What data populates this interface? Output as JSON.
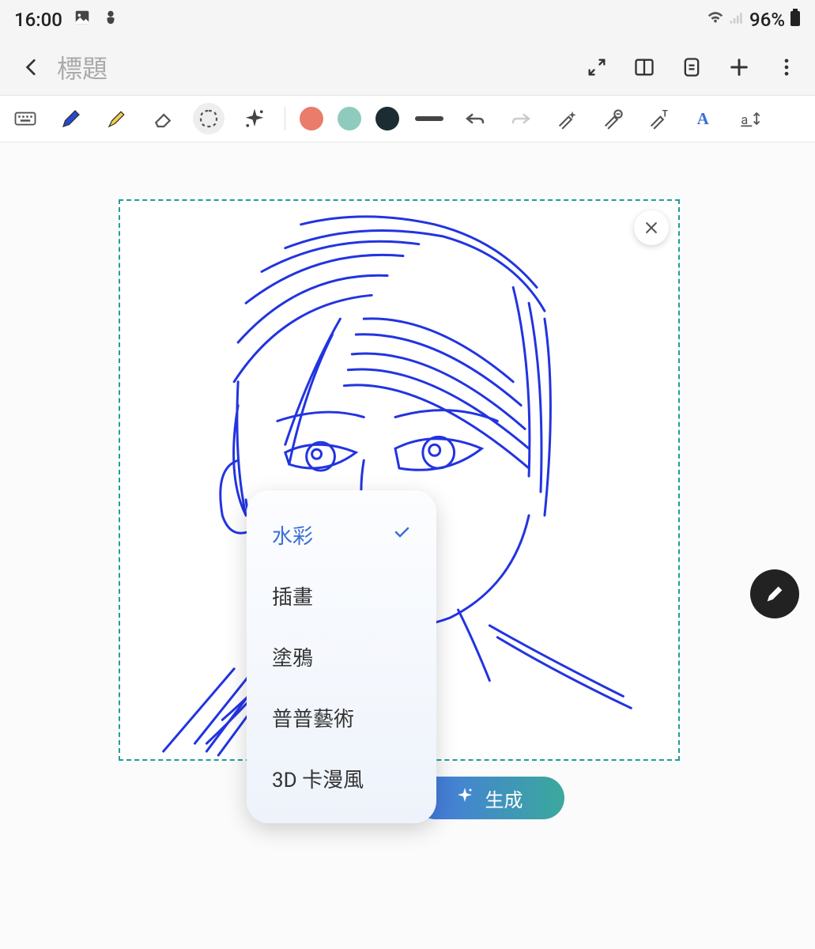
{
  "status": {
    "time": "16:00",
    "battery": "96%"
  },
  "header": {
    "title": "標題"
  },
  "toolbar": {
    "colors": {
      "coral": "#e97c6b",
      "mint": "#8fcbbd",
      "dark": "#1b2d33"
    }
  },
  "dropdown": {
    "items": [
      {
        "label": "水彩",
        "selected": true
      },
      {
        "label": "插畫",
        "selected": false
      },
      {
        "label": "塗鴉",
        "selected": false
      },
      {
        "label": "普普藝術",
        "selected": false
      },
      {
        "label": "3D 卡漫風",
        "selected": false
      }
    ]
  },
  "bottom": {
    "selected_style": "水彩",
    "generate": "生成"
  }
}
